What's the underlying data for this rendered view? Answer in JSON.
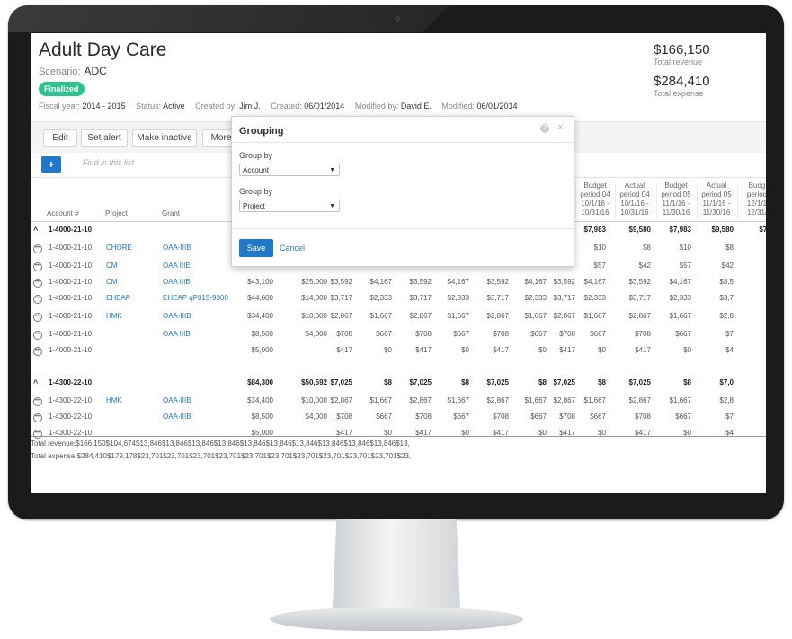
{
  "app": {
    "title": "Adult Day Care",
    "scenario_label": "Scenario:",
    "scenario_value": "ADC",
    "status_badge": "Finalized",
    "meta": {
      "fiscal_label": "Fiscal year:",
      "fiscal_value": "2014 - 2015",
      "status_label": "Status:",
      "status_value": "Active",
      "created_by_label": "Created by:",
      "created_by_value": "Jim J.",
      "created_label": "Created:",
      "created_value": "06/01/2014",
      "modified_by_label": "Modified by:",
      "modified_by_value": "David E.",
      "modified_label": "Modified:",
      "modified_value": "06/01/2014"
    },
    "totals": {
      "revenue_amount": "$166,150",
      "revenue_label": "Total revenue",
      "expense_amount": "$284,410",
      "expense_label": "Total expense"
    }
  },
  "toolbar": {
    "edit": "Edit",
    "set_alert": "Set alert",
    "make_inactive": "Make inactive",
    "more": "More",
    "search_placeholder": "Find in this list"
  },
  "table": {
    "headers": {
      "account": "Account #",
      "project": "Project",
      "grant": "Grant"
    },
    "periods": [
      {
        "l1": "Budget",
        "l2": "period 04",
        "l3": "10/1/16 -",
        "l4": "10/31/16"
      },
      {
        "l1": "Actual",
        "l2": "period 04",
        "l3": "10/1/16 -",
        "l4": "10/31/16"
      },
      {
        "l1": "Budget",
        "l2": "period 05",
        "l3": "11/1/16 -",
        "l4": "11/30/16"
      },
      {
        "l1": "Actual",
        "l2": "period 05",
        "l3": "11/1/16 -",
        "l4": "11/30/16"
      },
      {
        "l1": "Budg",
        "l2": "period",
        "l3": "12/1/1",
        "l4": "12/31/"
      }
    ],
    "rows": [
      {
        "kind": "group",
        "account": "1-4000-21-10",
        "project": "",
        "grant": "",
        "vals": [
          "",
          "",
          "",
          "",
          "",
          "",
          "",
          "",
          "",
          "$7,983",
          "$9,580",
          "$7,983",
          "$9,580",
          "$7,5"
        ]
      },
      {
        "kind": "item",
        "account": "1-4000-21-10",
        "project": "CHORE",
        "grant": "OAA-IIIB",
        "vals": [
          "",
          "",
          "",
          "",
          "",
          "",
          "",
          "",
          "",
          "$10",
          "$8",
          "$10",
          "$8",
          "$"
        ]
      },
      {
        "kind": "item",
        "account": "1-4000-21-10",
        "project": "CM",
        "grant": "OAA IIIE",
        "vals": [
          "",
          "",
          "",
          "",
          "",
          "",
          "",
          "",
          "",
          "$57",
          "$42",
          "$57",
          "$42",
          "$"
        ]
      },
      {
        "kind": "item",
        "account": "1-4000-21-10",
        "project": "CM",
        "grant": "OAA IIIB",
        "vals": [
          "$43,100",
          "$25,000",
          "$3,592",
          "$4,167",
          "$3,592",
          "$4,167",
          "$3,592",
          "$4,167",
          "$3,592",
          "$4,167",
          "$3,592",
          "$4,167",
          "$3,5"
        ]
      },
      {
        "kind": "item",
        "account": "1-4000-21-10",
        "project": "EHEAP",
        "grant": "EHEAP qP015-9300",
        "vals": [
          "$44,600",
          "$14,000",
          "$3,717",
          "$2,333",
          "$3,717",
          "$2,333",
          "$3,717",
          "$2,333",
          "$3,717",
          "$2,333",
          "$3,717",
          "$2,333",
          "$3,7"
        ]
      },
      {
        "kind": "item",
        "account": "1-4000-21-10",
        "project": "HMK",
        "grant": "OAA-IIIB",
        "vals": [
          "$34,400",
          "$10,000",
          "$2,867",
          "$1,667",
          "$2,867",
          "$1,667",
          "$2,867",
          "$1,667",
          "$2,867",
          "$1,667",
          "$2,867",
          "$1,667",
          "$2,8"
        ]
      },
      {
        "kind": "item",
        "account": "1-4000-21-10",
        "project": "",
        "grant": "OAA IIIB",
        "vals": [
          "$8,500",
          "$4,000",
          "$708",
          "$667",
          "$708",
          "$667",
          "$708",
          "$667",
          "$708",
          "$667",
          "$708",
          "$667",
          "$7"
        ]
      },
      {
        "kind": "item",
        "account": "1-4000-21-10",
        "project": "",
        "grant": "",
        "vals": [
          "$5,000",
          "",
          "$417",
          "$0",
          "$417",
          "$0",
          "$417",
          "$0",
          "$417",
          "$0",
          "$417",
          "$0",
          "$4"
        ]
      },
      {
        "kind": "group",
        "account": "1-4300-22-10",
        "project": "",
        "grant": "",
        "vals": [
          "$84,300",
          "$50,592",
          "$7,025",
          "$8",
          "$7,025",
          "$8",
          "$7,025",
          "$8",
          "$7,025",
          "$8",
          "$7,025",
          "$8",
          "$7,0"
        ]
      },
      {
        "kind": "item",
        "account": "1-4300-22-10",
        "project": "HMK",
        "grant": "OAA-IIIB",
        "vals": [
          "$34,400",
          "$10,000",
          "$2,867",
          "$1,667",
          "$2,867",
          "$1,667",
          "$2,867",
          "$1,667",
          "$2,867",
          "$1,667",
          "$2,867",
          "$1,667",
          "$2,8"
        ]
      },
      {
        "kind": "item",
        "account": "1-4300-22-10",
        "project": "",
        "grant": "OAA-IIIB",
        "vals": [
          "$8,500",
          "$4,000",
          "$708",
          "$667",
          "$708",
          "$667",
          "$708",
          "$667",
          "$708",
          "$667",
          "$708",
          "$667",
          "$7"
        ]
      },
      {
        "kind": "item",
        "account": "1-4300-22-10",
        "project": "",
        "grant": "",
        "vals": [
          "$5,000",
          "",
          "$417",
          "$0",
          "$417",
          "$0",
          "$417",
          "$0",
          "$417",
          "$0",
          "$417",
          "$0",
          "$4"
        ]
      }
    ],
    "totals": [
      {
        "label": "Total revenue:",
        "vals": [
          "$166,150",
          "$104,674",
          "$13,846",
          "$13,846",
          "$13,846",
          "$13,846",
          "$13,846",
          "$13,846",
          "$13,846",
          "$13,846",
          "$13,846",
          "$13,846",
          "$13,"
        ]
      },
      {
        "label": "Total expense:",
        "vals": [
          "$284,410",
          "$179,178",
          "$23,701",
          "$23,701",
          "$23,701",
          "$23,701",
          "$23,701",
          "$23,701",
          "$23,701",
          "$23,701",
          "$23,701",
          "$23,701",
          "$23,"
        ]
      }
    ]
  },
  "dialog": {
    "title": "Grouping",
    "help": "?",
    "close": "×",
    "group_by_1_label": "Group by",
    "group_by_1_value": "Account",
    "group_by_2_label": "Group by",
    "group_by_2_value": "Project",
    "save": "Save",
    "cancel": "Cancel"
  },
  "colors": {
    "accent": "#1f79c7",
    "badge": "#2bc48e",
    "bezel": "#1b1b1b"
  }
}
